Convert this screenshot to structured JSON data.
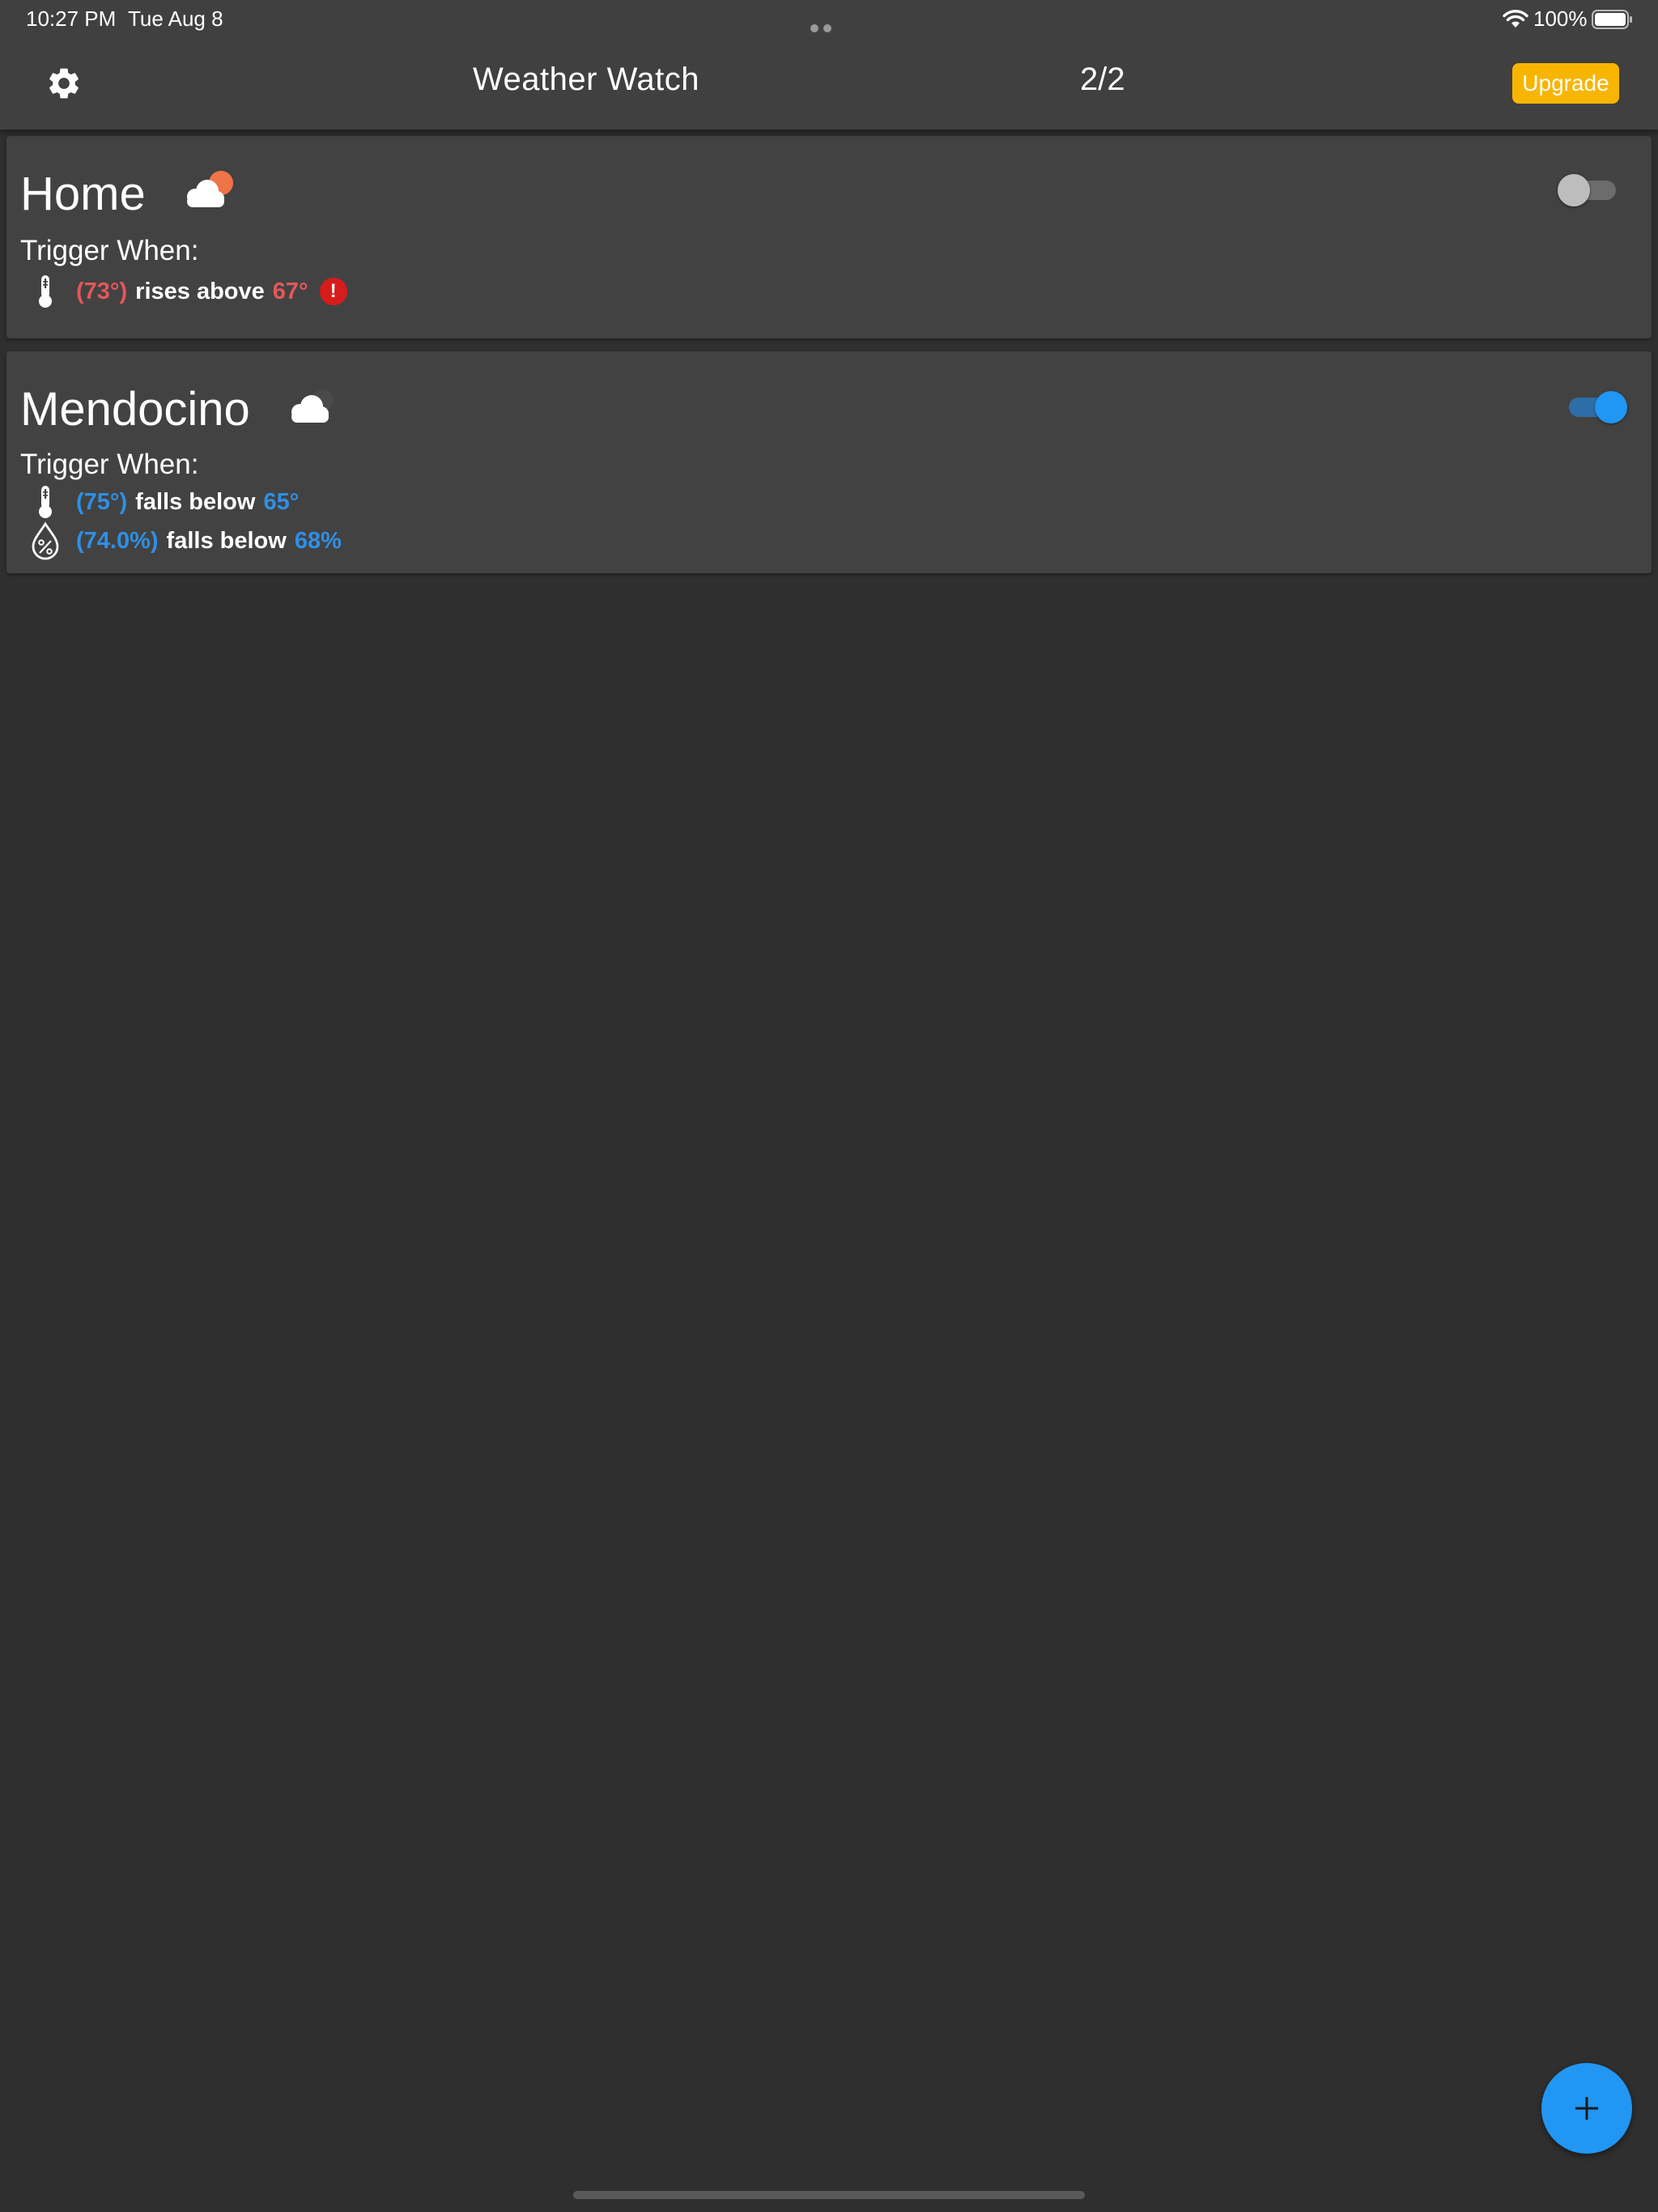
{
  "status_bar": {
    "time": "10:27 PM",
    "date": "Tue Aug 8",
    "battery": "100%"
  },
  "app_bar": {
    "title": "Weather Watch",
    "count": "2/2",
    "upgrade_label": "Upgrade"
  },
  "colors": {
    "accent_blue": "#2196f3",
    "alert_red": "#e4575a",
    "upgrade_amber": "#f7b500",
    "background": "#2f2f2f",
    "card": "#424242"
  },
  "locations": [
    {
      "name": "Home",
      "weather_icon": "partly-cloudy-day-icon",
      "enabled": false,
      "trigger_label": "Trigger When:",
      "conditions": [
        {
          "icon": "thermometer-icon",
          "current": "(73°)",
          "operator": "rises above",
          "threshold": "67°",
          "alert_glyph": "!"
        }
      ]
    },
    {
      "name": "Mendocino",
      "weather_icon": "partly-cloudy-night-icon",
      "enabled": true,
      "trigger_label": "Trigger When:",
      "conditions": [
        {
          "icon": "thermometer-icon",
          "current": "(75°)",
          "operator": "falls below",
          "threshold": "65°"
        },
        {
          "icon": "humidity-icon",
          "current": "(74.0%)",
          "operator": "falls below",
          "threshold": "68%"
        }
      ]
    }
  ]
}
